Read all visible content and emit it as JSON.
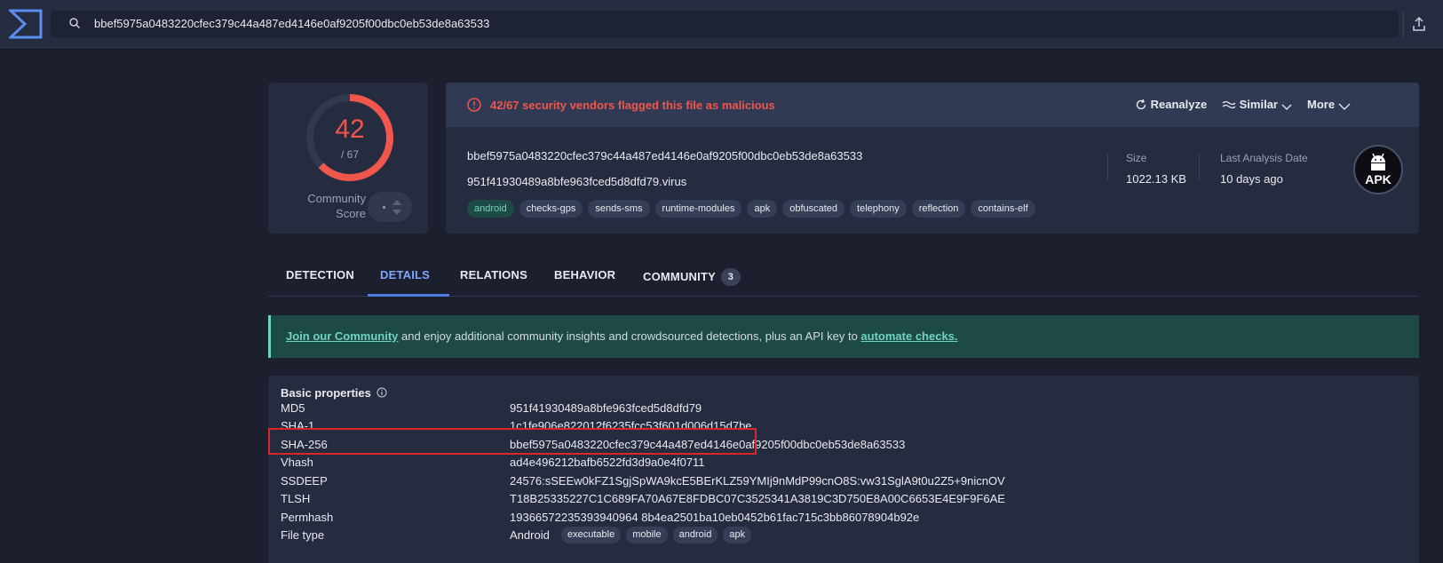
{
  "search": {
    "query": "bbef5975a0483220cfec379c44a487ed4146e0af9205f00dbc0eb53de8a63533"
  },
  "score": {
    "detected": "42",
    "total": "/ 67",
    "detected_fraction": 0.627,
    "community_label_1": "Community",
    "community_label_2": "Score",
    "color": "#f0564b"
  },
  "alert": {
    "text": "42/67 security vendors flagged this file as malicious",
    "actions": {
      "reanalyze": "Reanalyze",
      "similar": "Similar",
      "more": "More"
    }
  },
  "file": {
    "sha256": "bbef5975a0483220cfec379c44a487ed4146e0af9205f00dbc0eb53de8a63533",
    "name": "951f41930489a8bfe963fced5d8dfd79.virus",
    "tags": [
      "android",
      "checks-gps",
      "sends-sms",
      "runtime-modules",
      "apk",
      "obfuscated",
      "telephony",
      "reflection",
      "contains-elf"
    ],
    "size_label": "Size",
    "size_value": "1022.13 KB",
    "date_label": "Last Analysis Date",
    "date_value": "10 days ago",
    "type_badge": "APK"
  },
  "tabs": {
    "detection": "DETECTION",
    "details": "DETAILS",
    "relations": "RELATIONS",
    "behavior": "BEHAVIOR",
    "community": "COMMUNITY",
    "community_count": "3"
  },
  "banner": {
    "link1": "Join our Community",
    "middle": " and enjoy additional community insights and crowdsourced detections, plus an API key to ",
    "link2": "automate checks."
  },
  "basic_properties": {
    "title": "Basic properties",
    "rows": [
      {
        "key": "MD5",
        "value": "951f41930489a8bfe963fced5d8dfd79"
      },
      {
        "key": "SHA-1",
        "value": "1c1fe906e822012f6235fcc53f601d006d15d7be"
      },
      {
        "key": "SHA-256",
        "value": "bbef5975a0483220cfec379c44a487ed4146e0af9205f00dbc0eb53de8a63533"
      },
      {
        "key": "Vhash",
        "value": "ad4e496212bafb6522fd3d9a0e4f0711"
      },
      {
        "key": "SSDEEP",
        "value": "24576:sSEEw0kFZ1SgjSpWA9kcE5BErKLZ59YMIj9nMdP99cnO8S:vw31SglA9t0u2Z5+9nicnOV"
      },
      {
        "key": "TLSH",
        "value": "T18B25335227C1C689FA70A67E8FDBC07C3525341A3819C3D750E8A00C6653E4E9F9F6AE"
      },
      {
        "key": "Permhash",
        "value": "19366572235393940964 8b4ea2501ba10eb0452b61fac715c3bb86078904b92e"
      },
      {
        "key": "File type",
        "value": "Android"
      }
    ],
    "filetype_tags": [
      "executable",
      "mobile",
      "android",
      "apk"
    ]
  }
}
